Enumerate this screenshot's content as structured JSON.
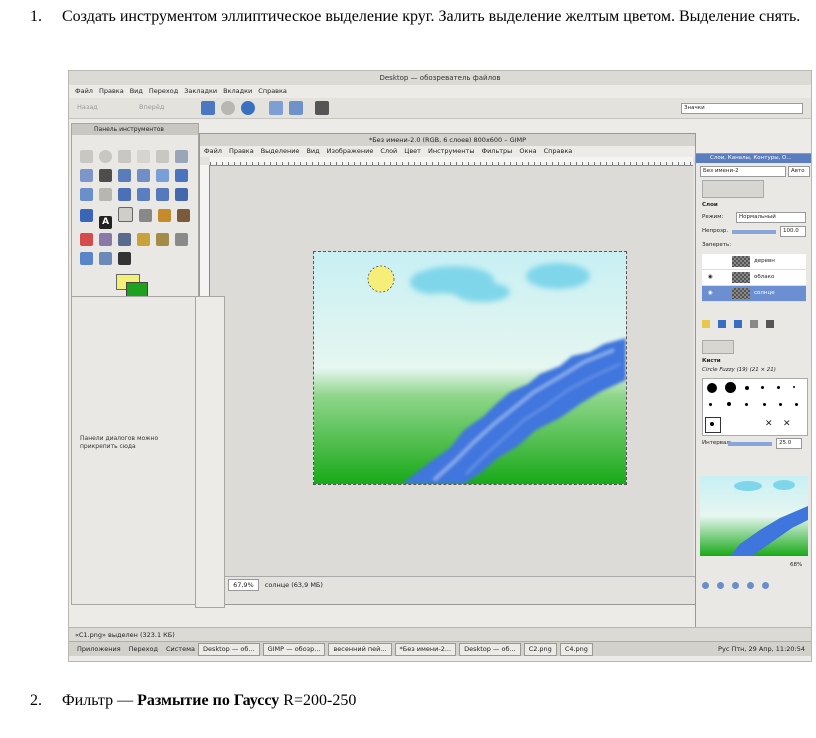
{
  "instructions": {
    "item1_num": "1.",
    "item1_text": "Создать инструментом эллиптическое выделение круг. Залить выделение желтым цветом. Выделение снять.",
    "item2_num": "2.",
    "item2_prefix": "Фильтр — ",
    "item2_bold": "Размытие по Гауссу",
    "item2_suffix": " R=200-250"
  },
  "file_manager": {
    "title": "Desktop — обозреватель файлов",
    "menu": [
      "Файл",
      "Правка",
      "Вид",
      "Переход",
      "Закладки",
      "Вкладки",
      "Справка"
    ],
    "back_label": "Назад",
    "forward_label": "Вперёд",
    "zoom_label": "Значки",
    "view_select": "Значки"
  },
  "toolbox": {
    "title": "Панель инструментов",
    "dock_note": "Панели диалогов можно прикрепить сюда"
  },
  "gimp": {
    "title": "*Без имени-2.0 (RGB, 6 слоев) 800x600 – GIMP",
    "menu": [
      "Файл",
      "Правка",
      "Выделение",
      "Вид",
      "Изображение",
      "Слой",
      "Цвет",
      "Инструменты",
      "Фильтры",
      "Окна",
      "Справка"
    ],
    "unit": "px",
    "zoom": "67,9%",
    "status": "солнце (63,9 МБ)",
    "colors": {
      "sky_top": "#c8f0f4",
      "sky_bottom": "#e6f6f0",
      "grass": "#22b022",
      "river": "#3f76dd",
      "sun": "#f5ee78",
      "cloud": "#7fd6ea"
    }
  },
  "right_dock": {
    "title": "Слои, Каналы, Контуры, О...",
    "image_select": "Без имени-2",
    "auto_label": "Авто",
    "layers_label": "Слои",
    "mode_label": "Режим:",
    "mode_value": "Нормальный",
    "opacity_label": "Непрозр.",
    "opacity_value": "100.0",
    "lock_label": "Запереть:",
    "layers": [
      "деревн",
      "облако",
      "солнце"
    ],
    "brushes_label": "Кисти",
    "brush_name": "Circle Fuzzy (19) (21 × 21)",
    "spacing_label": "Интервал:",
    "spacing_value": "25.0",
    "nav_zoom": "68%"
  },
  "taskbar": {
    "status_file": "«C1.png» выделен (323.1 КБ)",
    "tasks": [
      "Desktop — об...",
      "GIMP — обозр...",
      "весенний пей...",
      "*Без имени-2...",
      "Desktop — об...",
      "C2.png",
      "C4.png"
    ],
    "apps": "Приложения",
    "places": "Переход",
    "system": "Система",
    "clock": "Рус  Птн, 29 Апр, 11:20:54"
  }
}
